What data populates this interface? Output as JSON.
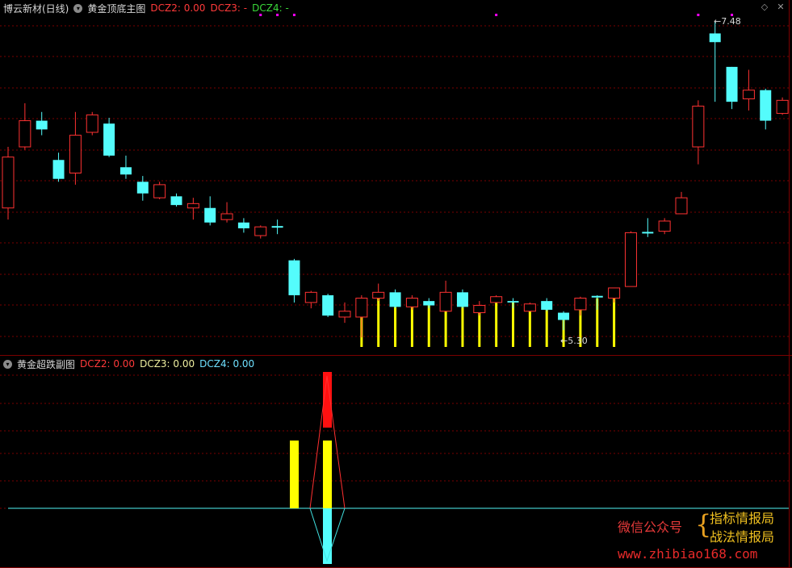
{
  "main": {
    "stock_name": "博云新材(日线)",
    "indicator_name": "黄金顶底主图",
    "dcz2": "DCZ2: 0.00",
    "dcz3": "DCZ3: -",
    "dcz4": "DCZ4: -",
    "high_label": "7.48",
    "low_label": "5.30",
    "candles": [
      {
        "o": 6.2,
        "c": 6.55,
        "h": 6.62,
        "l": 6.12,
        "type": "up"
      },
      {
        "o": 6.62,
        "c": 6.8,
        "h": 6.92,
        "l": 6.6,
        "type": "up"
      },
      {
        "o": 6.8,
        "c": 6.74,
        "h": 6.86,
        "l": 6.7,
        "type": "down"
      },
      {
        "o": 6.53,
        "c": 6.4,
        "h": 6.58,
        "l": 6.38,
        "type": "down"
      },
      {
        "o": 6.44,
        "c": 6.7,
        "h": 6.86,
        "l": 6.36,
        "type": "up"
      },
      {
        "o": 6.72,
        "c": 6.84,
        "h": 6.86,
        "l": 6.7,
        "type": "up"
      },
      {
        "o": 6.78,
        "c": 6.56,
        "h": 6.82,
        "l": 6.55,
        "type": "down"
      },
      {
        "o": 6.48,
        "c": 6.43,
        "h": 6.56,
        "l": 6.4,
        "type": "down"
      },
      {
        "o": 6.38,
        "c": 6.3,
        "h": 6.42,
        "l": 6.25,
        "type": "down"
      },
      {
        "o": 6.27,
        "c": 6.36,
        "h": 6.38,
        "l": 6.26,
        "type": "up"
      },
      {
        "o": 6.28,
        "c": 6.22,
        "h": 6.3,
        "l": 6.21,
        "type": "down"
      },
      {
        "o": 6.2,
        "c": 6.23,
        "h": 6.27,
        "l": 6.12,
        "type": "up"
      },
      {
        "o": 6.2,
        "c": 6.1,
        "h": 6.28,
        "l": 6.08,
        "type": "down"
      },
      {
        "o": 6.12,
        "c": 6.16,
        "h": 6.24,
        "l": 6.1,
        "type": "up"
      },
      {
        "o": 6.1,
        "c": 6.06,
        "h": 6.13,
        "l": 6.03,
        "type": "down"
      },
      {
        "o": 6.01,
        "c": 6.07,
        "h": 6.08,
        "l": 5.99,
        "type": "up"
      },
      {
        "o": 6.07,
        "c": 6.06,
        "h": 6.12,
        "l": 6.02,
        "type": "cross"
      },
      {
        "o": 5.84,
        "c": 5.6,
        "h": 5.85,
        "l": 5.55,
        "type": "down"
      },
      {
        "o": 5.55,
        "c": 5.62,
        "h": 5.63,
        "l": 5.51,
        "type": "up"
      },
      {
        "o": 5.6,
        "c": 5.46,
        "h": 5.61,
        "l": 5.45,
        "type": "down"
      },
      {
        "o": 5.45,
        "c": 5.49,
        "h": 5.55,
        "l": 5.41,
        "type": "up"
      },
      {
        "o": 5.45,
        "c": 5.58,
        "h": 5.6,
        "l": 5.31,
        "type": "up"
      },
      {
        "o": 5.58,
        "c": 5.62,
        "h": 5.68,
        "l": 5.56,
        "type": "up"
      },
      {
        "o": 5.62,
        "c": 5.52,
        "h": 5.64,
        "l": 5.51,
        "type": "down"
      },
      {
        "o": 5.52,
        "c": 5.58,
        "h": 5.6,
        "l": 5.5,
        "type": "up"
      },
      {
        "o": 5.56,
        "c": 5.53,
        "h": 5.58,
        "l": 5.51,
        "type": "down"
      },
      {
        "o": 5.49,
        "c": 5.62,
        "h": 5.7,
        "l": 5.49,
        "type": "up"
      },
      {
        "o": 5.62,
        "c": 5.52,
        "h": 5.64,
        "l": 5.51,
        "type": "down"
      },
      {
        "o": 5.48,
        "c": 5.53,
        "h": 5.56,
        "l": 5.46,
        "type": "up"
      },
      {
        "o": 5.55,
        "c": 5.59,
        "h": 5.6,
        "l": 5.55,
        "type": "up"
      },
      {
        "o": 5.56,
        "c": 5.55,
        "h": 5.58,
        "l": 5.51,
        "type": "down"
      },
      {
        "o": 5.49,
        "c": 5.54,
        "h": 5.55,
        "l": 5.49,
        "type": "up"
      },
      {
        "o": 5.56,
        "c": 5.5,
        "h": 5.58,
        "l": 5.49,
        "type": "down"
      },
      {
        "o": 5.48,
        "c": 5.43,
        "h": 5.49,
        "l": 5.36,
        "type": "down"
      },
      {
        "o": 5.5,
        "c": 5.58,
        "h": 5.59,
        "l": 5.46,
        "type": "up"
      },
      {
        "o": 5.58,
        "c": 5.59,
        "h": 5.6,
        "l": 5.5,
        "type": "cross"
      },
      {
        "o": 5.58,
        "c": 5.65,
        "h": 5.65,
        "l": 5.55,
        "type": "up"
      },
      {
        "o": 5.66,
        "c": 6.03,
        "h": 6.04,
        "l": 5.66,
        "type": "up"
      },
      {
        "o": 6.03,
        "c": 6.03,
        "h": 6.13,
        "l": 6.0,
        "type": "cross"
      },
      {
        "o": 6.04,
        "c": 6.11,
        "h": 6.13,
        "l": 6.02,
        "type": "up"
      },
      {
        "o": 6.16,
        "c": 6.27,
        "h": 6.31,
        "l": 6.16,
        "type": "up"
      },
      {
        "o": 6.62,
        "c": 6.9,
        "h": 6.94,
        "l": 6.5,
        "type": "up"
      },
      {
        "o": 7.34,
        "c": 7.4,
        "h": 7.48,
        "l": 6.93,
        "type": "down"
      },
      {
        "o": 7.17,
        "c": 6.93,
        "h": 7.17,
        "l": 6.88,
        "type": "down"
      },
      {
        "o": 6.95,
        "c": 7.01,
        "h": 7.15,
        "l": 6.87,
        "type": "up"
      },
      {
        "o": 7.01,
        "c": 6.8,
        "h": 7.02,
        "l": 6.74,
        "type": "down"
      },
      {
        "o": 6.85,
        "c": 6.94,
        "h": 6.96,
        "l": 6.84,
        "type": "up"
      }
    ],
    "signal_bars": [
      21,
      22,
      23,
      24,
      25,
      26,
      27,
      28,
      29,
      30,
      31,
      32,
      33,
      34,
      35,
      36
    ],
    "magenta_dots": [
      15,
      16,
      17,
      29,
      41,
      43
    ]
  },
  "sub": {
    "indicator_name": "黄金超跌副图",
    "dcz2": "DCZ2: 0.00",
    "dcz3": "DCZ3: 0.00",
    "dcz4": "DCZ4: 0.00"
  },
  "watermark": {
    "wechat": "微信公众号",
    "brace": "{",
    "line1": "指标情报局",
    "line2": "战法情报局",
    "url": "www.zhibiao168.com"
  },
  "colors": {
    "up": "#ff3232",
    "down": "#54fcfc",
    "yellow": "#ffff00",
    "grid": "#7a0000",
    "magenta": "#ff00ff"
  }
}
